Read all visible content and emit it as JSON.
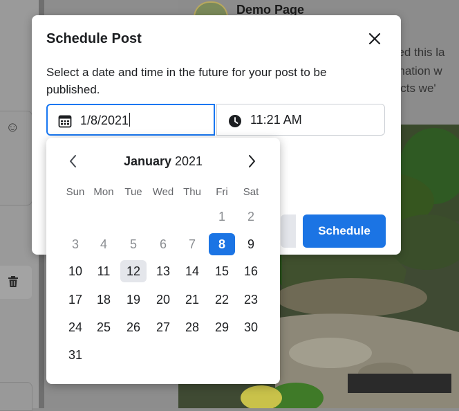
{
  "background": {
    "page_name": "Demo Page",
    "snippets": [
      "hed this la",
      "rmation w",
      "jects we'"
    ]
  },
  "modal": {
    "title": "Schedule Post",
    "description": "Select a date and time in the future for your post to be published.",
    "date_value": "1/8/2021",
    "time_value": "11:21 AM",
    "schedule_label": "Schedule",
    "accent_color": "#1b74e4"
  },
  "calendar": {
    "month": "January",
    "year": "2021",
    "weekdays": [
      "Sun",
      "Mon",
      "Tue",
      "Wed",
      "Thu",
      "Fri",
      "Sat"
    ],
    "weeks": [
      [
        "",
        "",
        "",
        "",
        "",
        "1",
        "2"
      ],
      [
        "3",
        "4",
        "5",
        "6",
        "7",
        "8",
        "9"
      ],
      [
        "10",
        "11",
        "12",
        "13",
        "14",
        "15",
        "16"
      ],
      [
        "17",
        "18",
        "19",
        "20",
        "21",
        "22",
        "23"
      ],
      [
        "24",
        "25",
        "26",
        "27",
        "28",
        "29",
        "30"
      ],
      [
        "31",
        "",
        "",
        "",
        "",
        "",
        ""
      ]
    ],
    "disabled_days": [
      "1",
      "2",
      "3",
      "4",
      "5",
      "6",
      "7"
    ],
    "today": "12",
    "selected": "8"
  }
}
